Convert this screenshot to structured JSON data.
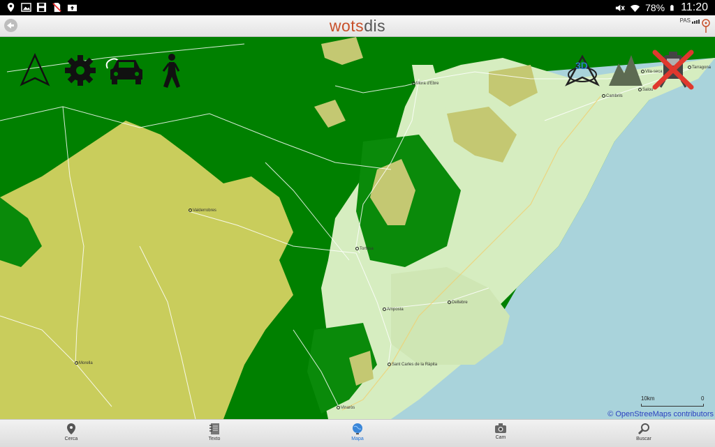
{
  "status_bar": {
    "left_icons": [
      "location-icon",
      "image-icon",
      "save-icon",
      "sim-off-icon",
      "photo-upload-icon"
    ],
    "right_icons": [
      "mute-icon",
      "wifi-icon",
      "battery-icon"
    ],
    "battery": "78%",
    "time": "11:20"
  },
  "header": {
    "title_part1": "wots",
    "title_part2": "dis",
    "signal_label": "PAS",
    "colors": {
      "title_accent": "#c8502a",
      "title_gray": "#555555"
    }
  },
  "map": {
    "places": [
      {
        "name": "Mora d'Ebre"
      },
      {
        "name": "Vila-seca"
      },
      {
        "name": "Tarragona"
      },
      {
        "name": "Cambrils"
      },
      {
        "name": "Salou"
      },
      {
        "name": "Valderrobres"
      },
      {
        "name": "Tortosa"
      },
      {
        "name": "Amposta"
      },
      {
        "name": "Deltebre"
      },
      {
        "name": "Sant Carles de la Ràpita"
      },
      {
        "name": "Vinaròs"
      },
      {
        "name": "Morella"
      }
    ],
    "tools_left": [
      "navigation-arrow-icon",
      "settings-gear-icon",
      "car-icon",
      "walking-person-icon"
    ],
    "tools_right": [
      "3d-view-icon",
      "mountain-relief-icon",
      "train-disabled-icon"
    ],
    "scale_label": "10km",
    "scale_zero": "0",
    "attribution": "© OpenStreeMaps contributors",
    "colors": {
      "forest": "#008000",
      "hills": "#c9cd5c",
      "lowland": "#d9efc3",
      "sea": "#a8d4dc"
    }
  },
  "bottom_nav": [
    {
      "label": "Cerca",
      "icon": "map-pin-icon"
    },
    {
      "label": "Texto",
      "icon": "notebook-icon"
    },
    {
      "label": "Mapa",
      "icon": "globe-icon",
      "active": true
    },
    {
      "label": "Cam",
      "icon": "camera-icon"
    },
    {
      "label": "Buscar",
      "icon": "magnifier-icon"
    }
  ]
}
